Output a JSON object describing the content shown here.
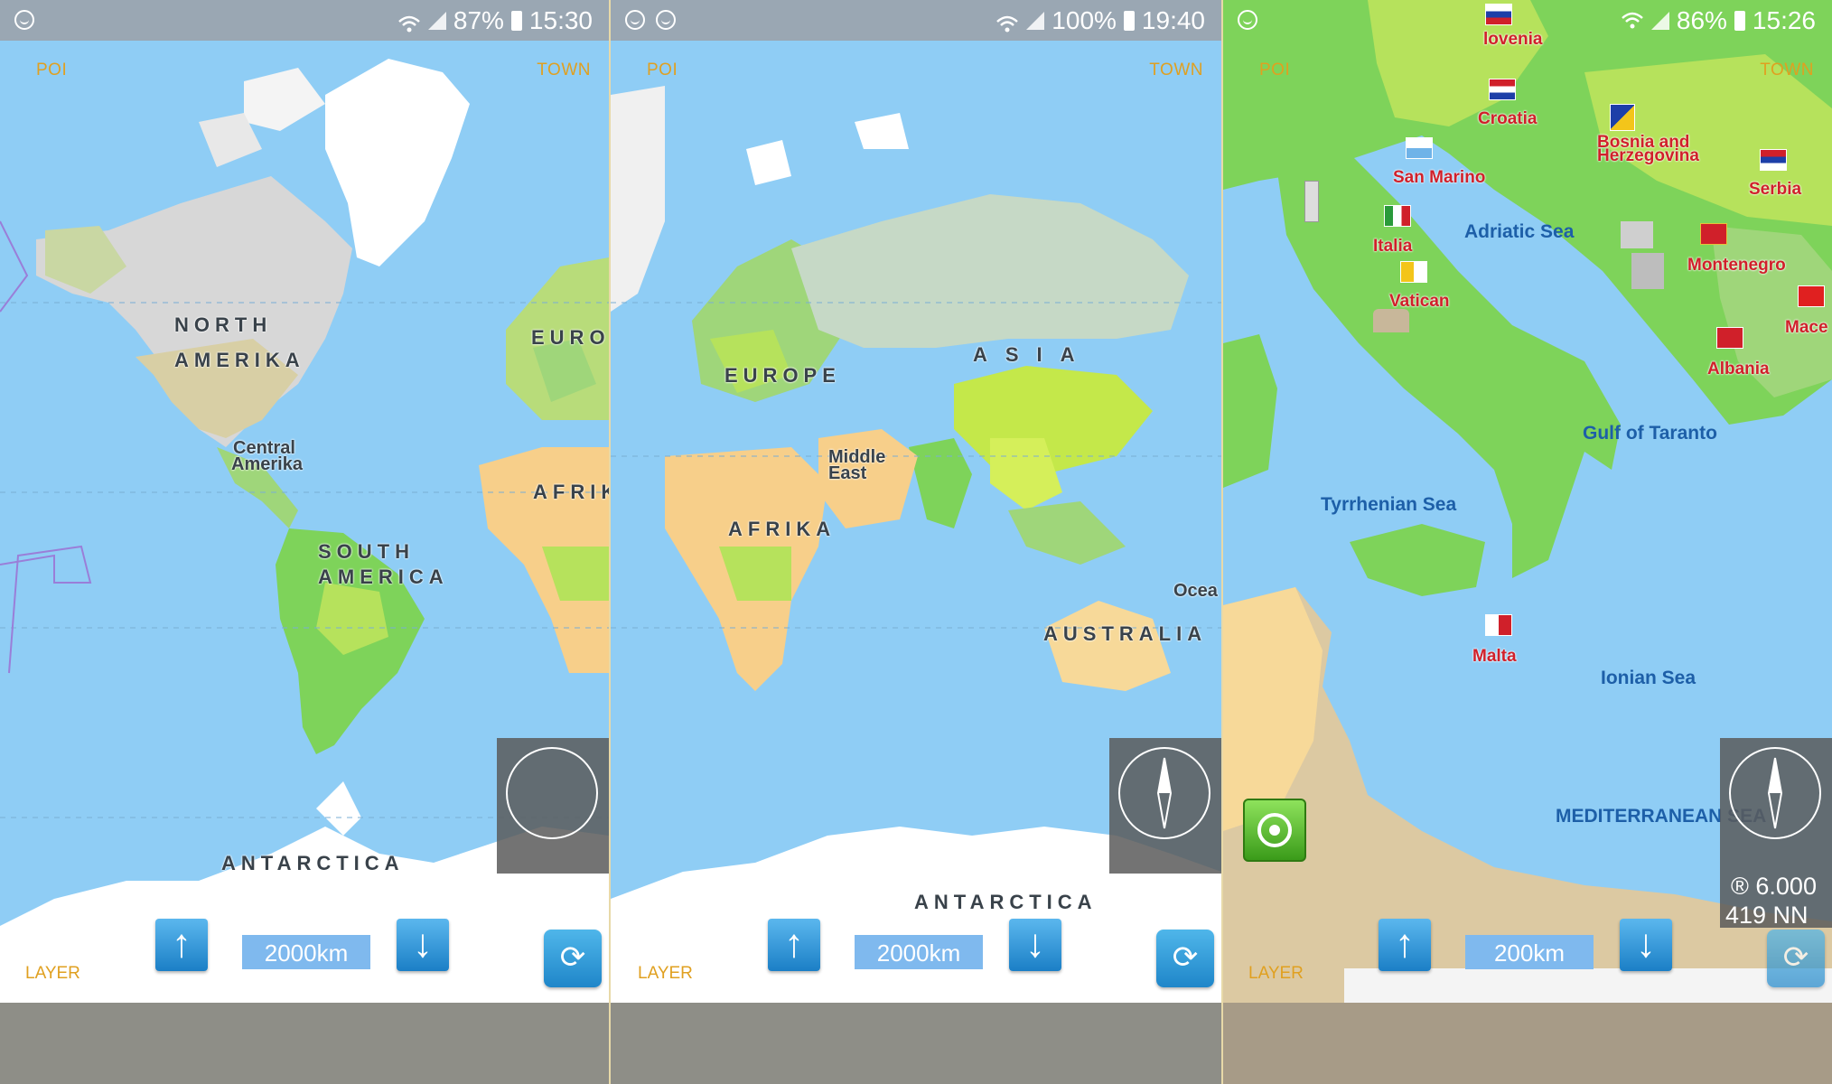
{
  "panels": [
    {
      "status": {
        "battery": "87%",
        "time": "15:30"
      },
      "corner": {
        "poi": "POI",
        "town": "TOWN",
        "layer": "LAYER"
      },
      "labels": {
        "north_america_1": "NORTH",
        "north_america_2": "AMERIKA",
        "europe": "EUROP",
        "central_1": "Central",
        "central_2": "Amerika",
        "africa": "AFRIK",
        "south_america_1": "SOUTH",
        "south_america_2": "AMERICA",
        "antarctica": "ANTARCTICA"
      },
      "scale": "2000km"
    },
    {
      "status": {
        "battery": "100%",
        "time": "19:40"
      },
      "corner": {
        "poi": "POI",
        "town": "TOWN",
        "layer": "LAYER"
      },
      "labels": {
        "asia": "ASIA",
        "europe": "EUROPE",
        "middle_east_1": "Middle",
        "middle_east_2": "East",
        "africa": "AFRIKA",
        "oceania": "Ocea",
        "australia": "AUSTRALIA",
        "antarctica": "ANTARCTICA"
      },
      "scale": "2000km"
    },
    {
      "status": {
        "battery": "86%",
        "time": "15:26"
      },
      "corner": {
        "poi": "POI",
        "town": "TOWN",
        "layer": "LAYER"
      },
      "countries": {
        "slovenia": "lovenia",
        "croatia": "Croatia",
        "bosnia": "Bosnia and Herzegovina",
        "san_marino": "San Marino",
        "serbia": "Serbia",
        "italia": "Italia",
        "montenegro": "Montenegro",
        "vatican": "Vatican",
        "macedonia": "Mace",
        "albania": "Albania",
        "malta": "Malta"
      },
      "seas": {
        "adriatic": "Adriatic Sea",
        "taranto": "Gulf of Taranto",
        "tyrrhenian": "Tyrrhenian Sea",
        "ionian": "Ionian Sea",
        "mediterranean": "MEDITERRANEAN SEA"
      },
      "info": {
        "line1": "® 6.000",
        "line2": "419 NN"
      },
      "scale": "200km"
    }
  ],
  "icons": {
    "zoom_in": "up-arrow-icon",
    "zoom_out": "down-arrow-icon",
    "rotate": "rotate-icon",
    "compass": "compass-icon",
    "gps": "gps-locate-icon"
  },
  "colors": {
    "ocean": "#8fcdf5",
    "status_bar": "#9aa7b3",
    "poi_text": "#e0a020",
    "sea_text": "#1d5fa8",
    "country_text": "#d0202a"
  }
}
